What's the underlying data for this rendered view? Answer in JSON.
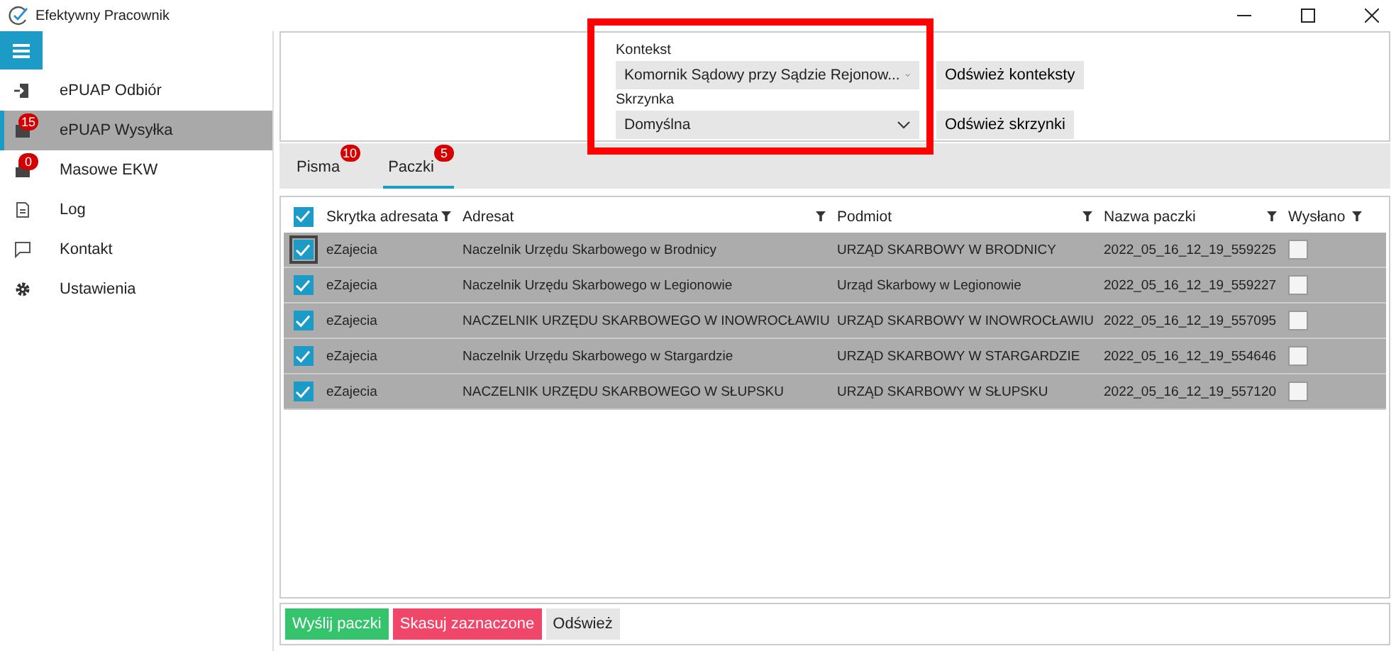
{
  "window": {
    "title": "Efektywny Pracownik"
  },
  "sidebar": {
    "items": [
      {
        "label": "ePUAP Odbiór",
        "selected": false
      },
      {
        "label": "ePUAP Wysyłka",
        "badge": "15",
        "selected": true
      },
      {
        "label": "Masowe EKW",
        "badge": "0",
        "selected": false
      },
      {
        "label": "Log",
        "selected": false
      },
      {
        "label": "Kontakt",
        "selected": false
      },
      {
        "label": "Ustawienia",
        "selected": false
      }
    ]
  },
  "context": {
    "label": "Kontekst",
    "value": "Komornik Sądowy przy Sądzie Rejonow...",
    "button": "Odśwież konteksty"
  },
  "mailbox": {
    "label": "Skrzynka",
    "value": "Domyślna",
    "button": "Odśwież skrzynki"
  },
  "tabs": [
    {
      "label": "Pisma",
      "badge": "10",
      "selected": false
    },
    {
      "label": "Paczki",
      "badge": "5",
      "selected": true
    }
  ],
  "table": {
    "all_checked": true,
    "columns": [
      "Skrytka adresata",
      "Adresat",
      "Podmiot",
      "Nazwa paczki",
      "Wysłano"
    ],
    "rows": [
      {
        "checked": true,
        "selected": true,
        "cells": [
          "eZajecia",
          "Naczelnik Urzędu Skarbowego w Brodnicy",
          "URZĄD SKARBOWY W BRODNICY",
          "2022_05_16_12_19_559225"
        ],
        "sent": false
      },
      {
        "checked": true,
        "selected": true,
        "cells": [
          "eZajecia",
          "Naczelnik Urzędu Skarbowego w Legionowie",
          "Urząd Skarbowy w Legionowie",
          "2022_05_16_12_19_559227"
        ],
        "sent": false
      },
      {
        "checked": true,
        "selected": true,
        "cells": [
          "eZajecia",
          "NACZELNIK URZĘDU SKARBOWEGO W INOWROCŁAWIU",
          "URZĄD SKARBOWY W INOWROCŁAWIU",
          "2022_05_16_12_19_557095"
        ],
        "sent": false
      },
      {
        "checked": true,
        "selected": true,
        "cells": [
          "eZajecia",
          "Naczelnik Urzędu Skarbowego w Stargardzie",
          "URZĄD SKARBOWY W STARGARDZIE",
          "2022_05_16_12_19_554646"
        ],
        "sent": false
      },
      {
        "checked": true,
        "selected": true,
        "cells": [
          "eZajecia",
          "NACZELNIK URZĘDU SKARBOWEGO W SŁUPSKU",
          "URZĄD SKARBOWY W SŁUPSKU",
          "2022_05_16_12_19_557120"
        ],
        "sent": false
      }
    ]
  },
  "buttons": [
    {
      "label": "Wyślij paczki",
      "kind": "primary"
    },
    {
      "label": "Skasuj zaznaczone",
      "kind": "danger"
    },
    {
      "label": "Odśwież",
      "kind": "plain"
    }
  ]
}
